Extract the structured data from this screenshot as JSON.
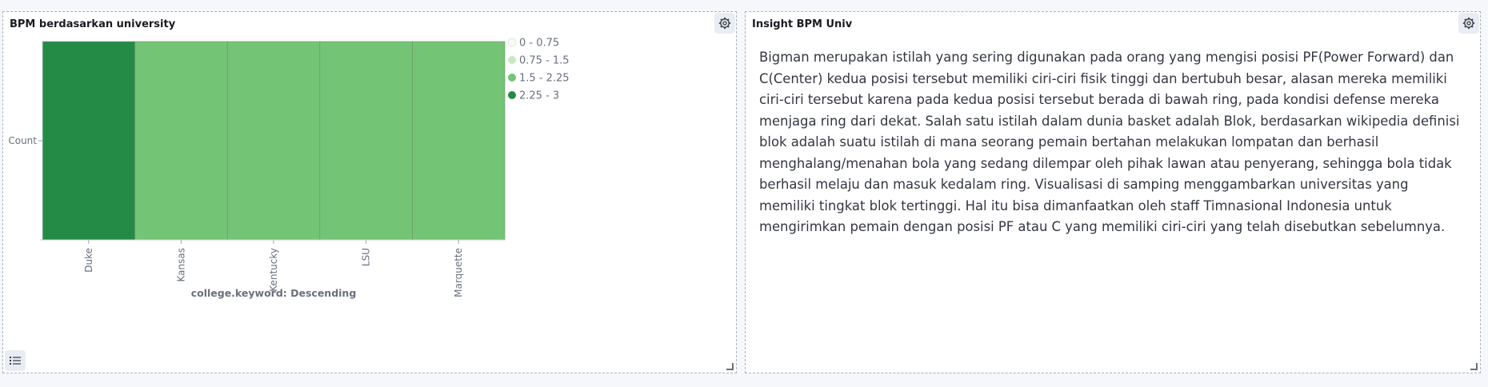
{
  "panels": {
    "left": {
      "title": "BPM berdasarkan university"
    },
    "right": {
      "title": "Insight BPM Univ",
      "body": "Bigman merupakan istilah yang sering digunakan pada orang yang mengisi posisi PF(Power Forward) dan C(Center) kedua posisi tersebut memiliki ciri-ciri fisik tinggi dan bertubuh besar, alasan mereka memiliki ciri-ciri tersebut karena pada kedua posisi tersebut berada di bawah ring, pada kondisi defense mereka menjaga ring dari dekat. Salah satu istilah dalam dunia basket adalah Blok, berdasarkan wikipedia definisi blok adalah suatu istilah di mana seorang pemain bertahan melakukan lompatan dan berhasil menghalang/menahan bola yang sedang dilempar oleh pihak lawan atau penyerang, sehingga bola tidak berhasil melaju dan masuk kedalam ring. Visualisasi di samping menggambarkan universitas yang memiliki tingkat blok tertinggi. Hal itu bisa dimanfaatkan oleh staff Timnasional Indonesia untuk mengirimkan pemain dengan posisi PF atau C yang memiliki ciri-ciri yang telah disebutkan sebelumnya."
    }
  },
  "icons": {
    "settings": "gear-icon",
    "legend": "list-icon",
    "resize": "resize-icon"
  },
  "chart_data": {
    "type": "heatmap",
    "title": "",
    "xlabel": "college.keyword: Descending",
    "ylabel": "Count",
    "categories": [
      "Duke",
      "Kansas",
      "Kentucky",
      "LSU",
      "Marquette"
    ],
    "y_categories": [
      "Count"
    ],
    "values": [
      2.5,
      2,
      2,
      2,
      2
    ],
    "legend_position": "right",
    "legend": [
      {
        "label": "0 - 0.75",
        "color": "#f7fcf5"
      },
      {
        "label": "0.75 - 1.5",
        "color": "#c7e9c0"
      },
      {
        "label": "1.5 - 2.25",
        "color": "#74c476"
      },
      {
        "label": "2.25 - 3",
        "color": "#238b45"
      }
    ]
  }
}
